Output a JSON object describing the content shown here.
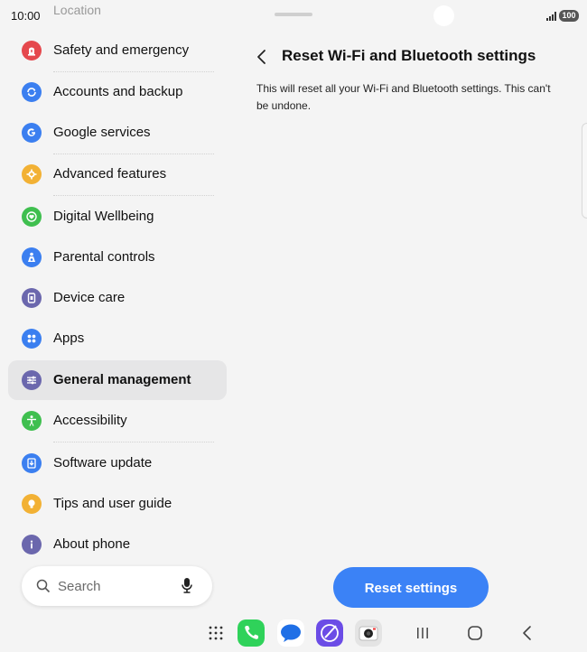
{
  "status_bar": {
    "time": "10:00",
    "battery": "100"
  },
  "settings_list": {
    "cut_off_item": "Location",
    "items": [
      {
        "label": "Safety and emergency",
        "icon": "safety-icon",
        "color": "#e5484d"
      },
      {
        "label": "Accounts and backup",
        "icon": "sync-icon",
        "color": "#3b7ff0"
      },
      {
        "label": "Google services",
        "icon": "google-icon",
        "color": "#3b7ff0"
      },
      {
        "label": "Advanced features",
        "icon": "gear-plus-icon",
        "color": "#f2b134"
      },
      {
        "label": "Digital Wellbeing",
        "icon": "heart-icon",
        "color": "#3fbf4f"
      },
      {
        "label": "Parental controls",
        "icon": "family-icon",
        "color": "#3b7ff0"
      },
      {
        "label": "Device care",
        "icon": "device-icon",
        "color": "#6b67ad"
      },
      {
        "label": "Apps",
        "icon": "apps-icon",
        "color": "#3b7ff0"
      },
      {
        "label": "General management",
        "icon": "sliders-icon",
        "color": "#6b67ad"
      },
      {
        "label": "Accessibility",
        "icon": "accessibility-icon",
        "color": "#3fbf4f"
      },
      {
        "label": "Software update",
        "icon": "update-icon",
        "color": "#3b7ff0"
      },
      {
        "label": "Tips and user guide",
        "icon": "bulb-icon",
        "color": "#f2b134"
      },
      {
        "label": "About phone",
        "icon": "info-icon",
        "color": "#6b67ad"
      }
    ],
    "selected_index": 8
  },
  "search": {
    "placeholder": "Search"
  },
  "detail": {
    "title": "Reset Wi-Fi and Bluetooth settings",
    "description": "This will reset all your Wi-Fi and Bluetooth settings. This can't be undone.",
    "reset_button_label": "Reset settings",
    "accent_color": "#3b82f6"
  }
}
